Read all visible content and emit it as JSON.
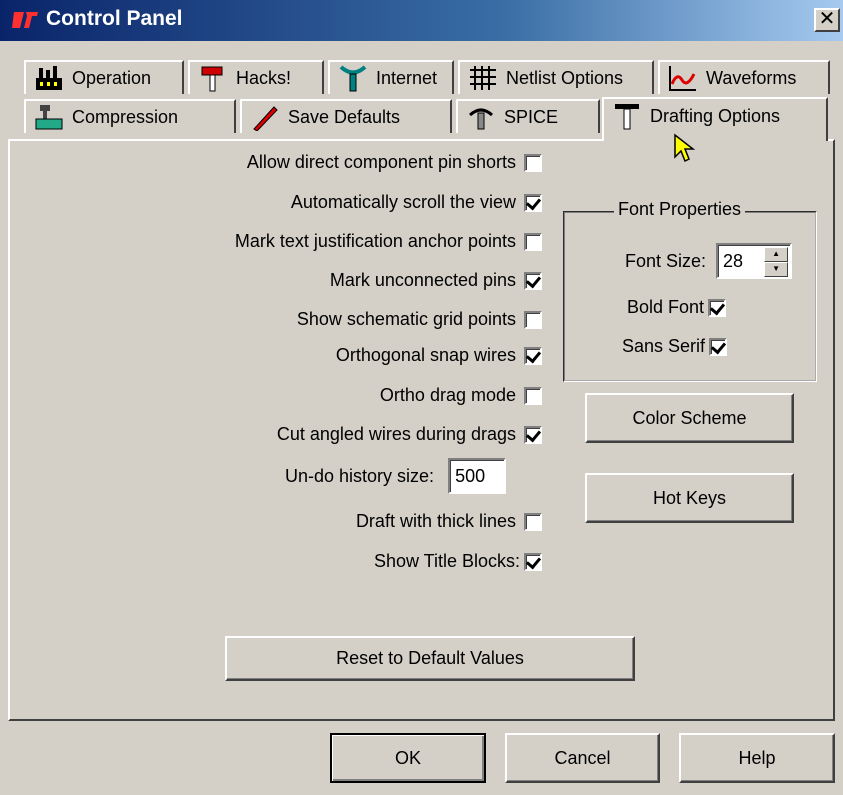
{
  "window": {
    "title": "Control Panel",
    "close_label": "✕"
  },
  "tabs_row1": [
    {
      "label": "Operation",
      "icon": "factory-icon"
    },
    {
      "label": "Hacks!",
      "icon": "hammer-icon"
    },
    {
      "label": "Internet",
      "icon": "antenna-icon"
    },
    {
      "label": "Netlist Options",
      "icon": "netlist-grid-icon"
    },
    {
      "label": "Waveforms",
      "icon": "waveform-icon"
    }
  ],
  "tabs_row2": [
    {
      "label": "Compression",
      "icon": "compression-clamp-icon"
    },
    {
      "label": "Save Defaults",
      "icon": "save-pen-icon"
    },
    {
      "label": "SPICE",
      "icon": "spice-tool-icon"
    },
    {
      "label": "Drafting Options",
      "icon": "drafting-tool-icon",
      "active": true
    }
  ],
  "options": [
    {
      "label": "Allow direct component pin shorts",
      "checked": false
    },
    {
      "label": "Automatically scroll the view",
      "checked": true
    },
    {
      "label": "Mark text justification anchor points",
      "checked": false
    },
    {
      "label": "Mark unconnected pins",
      "checked": true
    },
    {
      "label": "Show schematic grid points",
      "checked": false
    },
    {
      "label": "Orthogonal snap wires",
      "checked": true
    },
    {
      "label": "Ortho drag mode",
      "checked": false
    },
    {
      "label": "Cut angled wires during drags",
      "checked": true
    }
  ],
  "undo_history": {
    "label": "Un-do history size:",
    "value": "500"
  },
  "options_lower": [
    {
      "label": "Draft with thick lines",
      "checked": false
    },
    {
      "label": "Show Title Blocks:",
      "checked": true
    }
  ],
  "font_properties": {
    "legend": "Font Properties",
    "size_label": "Font Size:",
    "size_value": "28",
    "bold_label": "Bold Font",
    "bold_checked": true,
    "sans_label": "Sans Serif",
    "sans_checked": true
  },
  "buttons": {
    "color_scheme": "Color Scheme",
    "hot_keys": "Hot Keys",
    "reset": "Reset to Default Values",
    "ok": "OK",
    "cancel": "Cancel",
    "help": "Help"
  }
}
